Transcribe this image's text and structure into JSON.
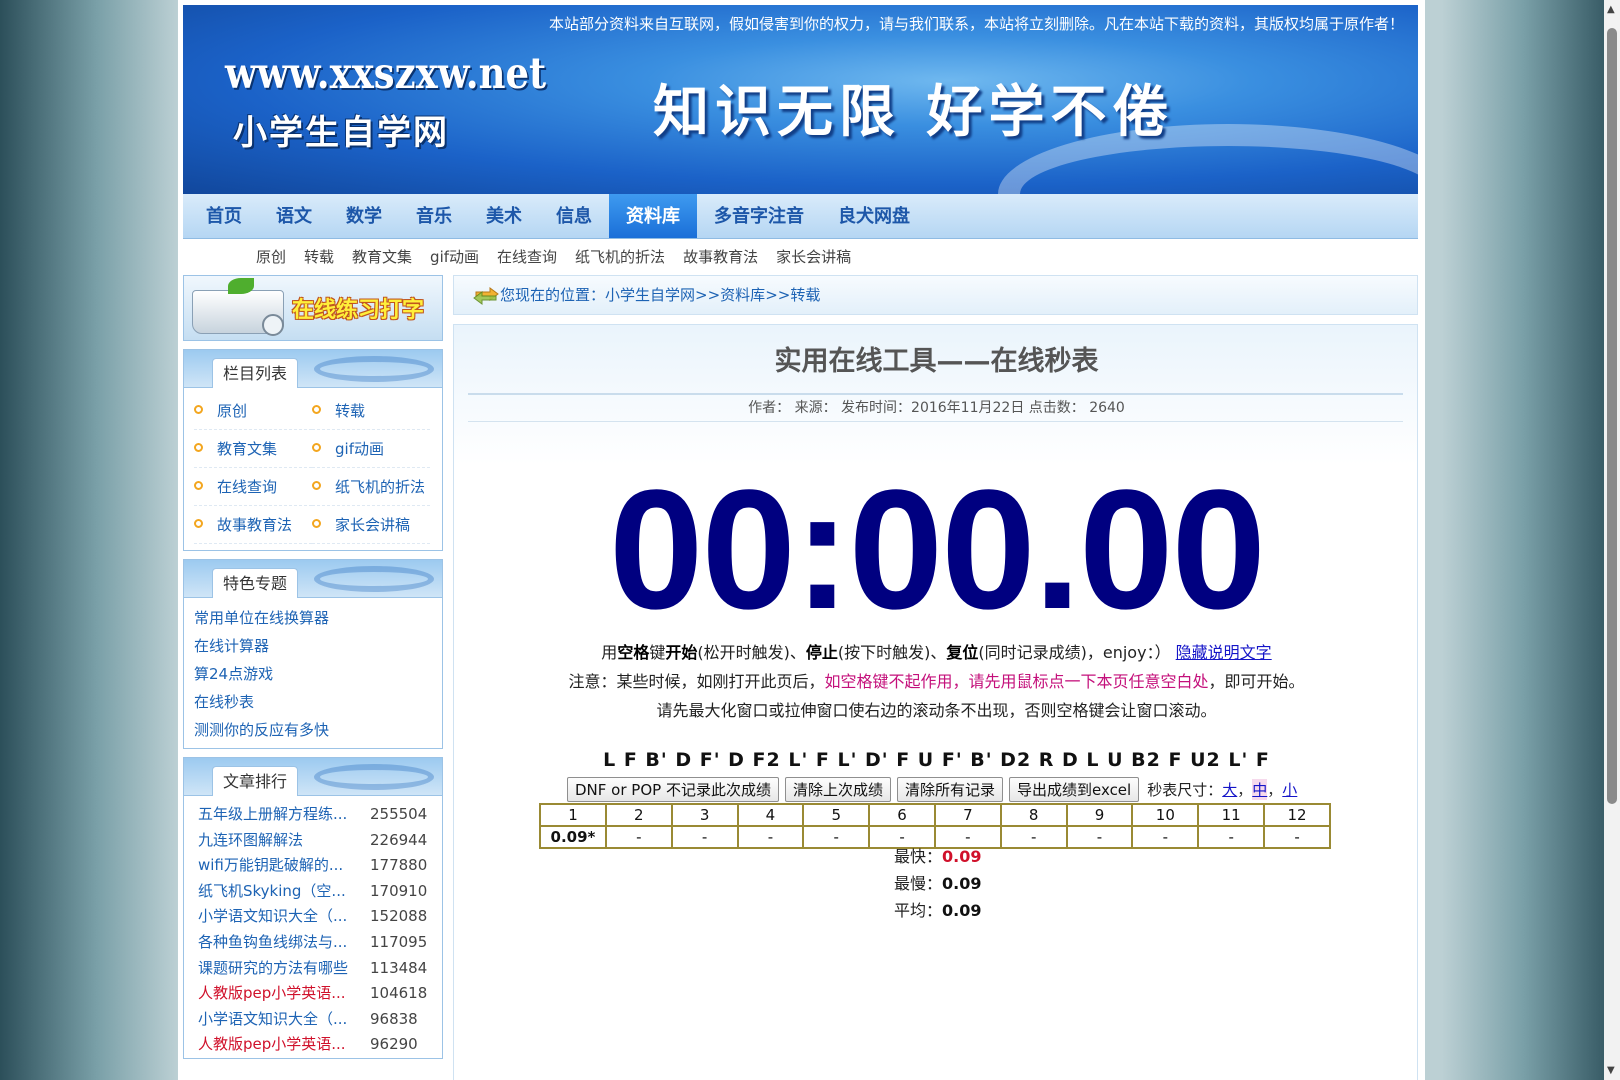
{
  "banner": {
    "notice": "本站部分资料来自互联网，假如侵害到你的权力，请与我们联系，本站将立刻删除。凡在本站下载的资料，其版权均属于原作者！",
    "url": "www.xxszxw.net",
    "site_name": "小学生自学网",
    "slogan": "知识无限  好学不倦"
  },
  "nav": {
    "items": [
      "首页",
      "语文",
      "数学",
      "音乐",
      "美术",
      "信息",
      "资料库",
      "多音字注音",
      "良犬网盘"
    ],
    "active": "资料库"
  },
  "subnav": [
    "原创",
    "转载",
    "教育文集",
    "gif动画",
    "在线查询",
    "纸飞机的折法",
    "故事教育法",
    "家长会讲稿"
  ],
  "sidebar": {
    "typing_label": "在线练习打字",
    "columns_title": "栏目列表",
    "columns": [
      "原创",
      "转载",
      "教育文集",
      "gif动画",
      "在线查询",
      "纸飞机的折法",
      "故事教育法",
      "家长会讲稿"
    ],
    "featured_title": "特色专题",
    "featured": [
      "常用单位在线换算器",
      "在线计算器",
      "算24点游戏",
      "在线秒表",
      "测测你的反应有多快"
    ],
    "ranking_title": "文章排行",
    "ranking": [
      {
        "title": "五年级上册解方程练...",
        "count": "255504",
        "color": "#1d63b4"
      },
      {
        "title": "九连环图解解法",
        "count": "226944",
        "color": "#1d63b4"
      },
      {
        "title": "wifi万能钥匙破解的...",
        "count": "177880",
        "color": "#1d63b4"
      },
      {
        "title": "纸飞机Skyking（空...",
        "count": "170910",
        "color": "#1d63b4"
      },
      {
        "title": "小学语文知识大全（...",
        "count": "152088",
        "color": "#1d63b4"
      },
      {
        "title": "各种鱼钩鱼线绑法与...",
        "count": "117095",
        "color": "#1d63b4"
      },
      {
        "title": "课题研究的方法有哪些",
        "count": "113484",
        "color": "#1d63b4"
      },
      {
        "title": "人教版pep小学英语...",
        "count": "104618",
        "color": "#d0112b"
      },
      {
        "title": "小学语文知识大全（...",
        "count": "96838",
        "color": "#1d63b4"
      },
      {
        "title": "人教版pep小学英语...",
        "count": "96290",
        "color": "#d0112b"
      }
    ]
  },
  "breadcrumb": {
    "prefix": "您现在的位置：",
    "items": [
      "小学生自学网",
      "资料库",
      "转载"
    ],
    "sep": ">>"
  },
  "article": {
    "title": "实用在线工具——在线秒表",
    "meta": "作者：  来源：  发布时间：2016年11月22日  点击数：  2640"
  },
  "timer": {
    "display": "00:00.00",
    "line1_a": "用",
    "line1_key": "空格",
    "line1_b": "键",
    "line1_start": "开始",
    "line1_c": "(松开时触发)、",
    "line1_stop": "停止",
    "line1_d": "(按下时触发)、",
    "line1_reset": "复位",
    "line1_e": "(同时记录成绩)，enjoy：）",
    "hide_link": "隐藏说明文字",
    "line2_a": "注意：某些时候，如刚打开此页后，",
    "line2_pink": "如空格键不起作用，请先用鼠标点一下本页任意空白处",
    "line2_b": "，即可开始。",
    "line3": "请先最大化窗口或拉伸窗口使右边的滚动条不出现，否则空格键会让窗口滚动。",
    "scramble": "L F B' D F' D F2 L' F L' D' F U F' B' D2 R D L U B2 F U2 L' F",
    "btn_dnf": "DNF or POP 不记录此次成绩",
    "btn_clear_last": "清除上次成绩",
    "btn_clear_all": "清除所有记录",
    "btn_export": "导出成绩到excel",
    "size_label": "秒表尺寸：",
    "size_large": "大",
    "size_medium": "中",
    "size_small": "小",
    "sep": "，",
    "headers": [
      "1",
      "2",
      "3",
      "4",
      "5",
      "6",
      "7",
      "8",
      "9",
      "10",
      "11",
      "12"
    ],
    "results": [
      "0.09*",
      "-",
      "-",
      "-",
      "-",
      "-",
      "-",
      "-",
      "-",
      "-",
      "-",
      "-"
    ],
    "fastest_label": "最快：",
    "fastest": "0.09",
    "slowest_label": "最慢：",
    "slowest": "0.09",
    "average_label": "平均：",
    "average": "0.09"
  },
  "icons": {
    "breadcrumb": "arrow-swap-icon",
    "bullet": "circle-bullet-icon"
  }
}
